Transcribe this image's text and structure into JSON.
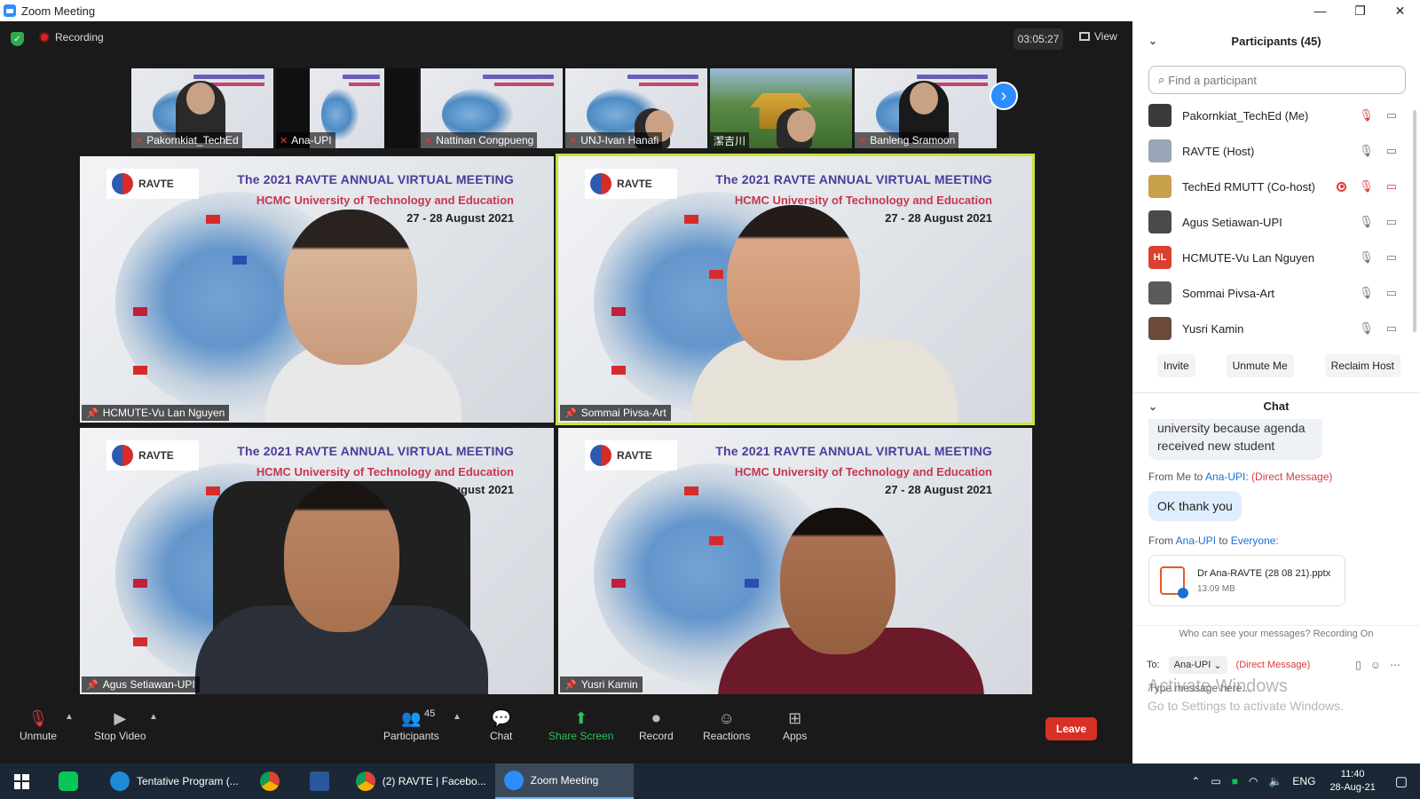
{
  "window": {
    "title": "Zoom Meeting",
    "minimize": "—",
    "restore": "❐",
    "close": "✕"
  },
  "topbar": {
    "recording_label": "Recording",
    "timer": "03:05:27",
    "view_label": "View"
  },
  "thumbnails": [
    {
      "name": "Pakornkiat_TechEd",
      "type": "person"
    },
    {
      "name": "Ana-UPI",
      "type": "slide"
    },
    {
      "name": "Nattinan Congpueng",
      "type": "slide"
    },
    {
      "name": "UNJ-Ivan Hanafi",
      "type": "slide"
    },
    {
      "name": "潔吉川",
      "type": "temple"
    },
    {
      "name": "Banleng Sramoon",
      "type": "person"
    }
  ],
  "slide": {
    "logo_text": "RAVTE",
    "title": "The 2021 RAVTE ANNUAL VIRTUAL MEETING",
    "subtitle": "HCMC University of Technology and Education",
    "dates": "27 - 28 August 2021"
  },
  "tiles": [
    {
      "name": "HCMUTE-Vu Lan Nguyen",
      "active": false
    },
    {
      "name": "Sommai Pivsa-Art",
      "active": true
    },
    {
      "name": "Agus Setiawan-UPI",
      "active": false
    },
    {
      "name": "Yusri Kamin",
      "active": false
    }
  ],
  "toolbar": {
    "unmute": "Unmute",
    "stop_video": "Stop Video",
    "participants": "Participants",
    "participant_count": "45",
    "chat": "Chat",
    "share_screen": "Share Screen",
    "record": "Record",
    "reactions": "Reactions",
    "apps": "Apps",
    "leave": "Leave"
  },
  "participants_panel": {
    "title": "Participants (45)",
    "search_placeholder": "Find a participant",
    "list": [
      {
        "name": "Pakornkiat_TechEd (Me)",
        "avatar_color": "#3a3a3a",
        "initials": ""
      },
      {
        "name": "RAVTE (Host)",
        "avatar_color": "#9aa6b8",
        "initials": ""
      },
      {
        "name": "TechEd RMUTT (Co-host)",
        "avatar_color": "#c9a04a",
        "initials": ""
      },
      {
        "name": "Agus Setiawan-UPI",
        "avatar_color": "#4a4a4a",
        "initials": ""
      },
      {
        "name": "HCMUTE-Vu Lan Nguyen",
        "avatar_color": "#d9402f",
        "initials": "HL"
      },
      {
        "name": "Sommai Pivsa-Art",
        "avatar_color": "#5a5a5a",
        "initials": ""
      },
      {
        "name": "Yusri Kamin",
        "avatar_color": "#6b4a3a",
        "initials": ""
      }
    ],
    "invite": "Invite",
    "unmute_me": "Unmute Me",
    "reclaim_host": "Reclaim Host"
  },
  "chat": {
    "title": "Chat",
    "fragment": "university because agenda received new student",
    "meta1": {
      "from": "From Me to",
      "to": "Ana-UPI:",
      "dm": "(Direct Message)"
    },
    "bubble": "OK thank you",
    "meta2": {
      "from": "From",
      "sender": "Ana-UPI",
      "to_word": "to",
      "to": "Everyone:"
    },
    "file": {
      "name": "Dr Ana-RAVTE (28 08 21).pptx",
      "size": "13.09 MB"
    },
    "who_can_see": "Who can see your messages? Recording On",
    "to_label": "To:",
    "to_value": "Ana-UPI",
    "to_dm": "(Direct Message)",
    "placeholder": "Type message here..."
  },
  "watermark": {
    "line1": "Activate Windows",
    "line2": "Go to Settings to activate Windows."
  },
  "taskbar": {
    "apps": [
      {
        "label": "",
        "color": "#06c755"
      },
      {
        "label": "Tentative Program (...",
        "color": "#1e8ad6"
      },
      {
        "label": "",
        "color": "#e8b52a"
      },
      {
        "label": "",
        "color": "#2b579a"
      },
      {
        "label": "(2) RAVTE | Facebo...",
        "color": "#e8b52a"
      },
      {
        "label": "Zoom Meeting",
        "color": "#2d8cff"
      }
    ],
    "lang": "ENG",
    "time": "11:40",
    "date": "28-Aug-21"
  }
}
